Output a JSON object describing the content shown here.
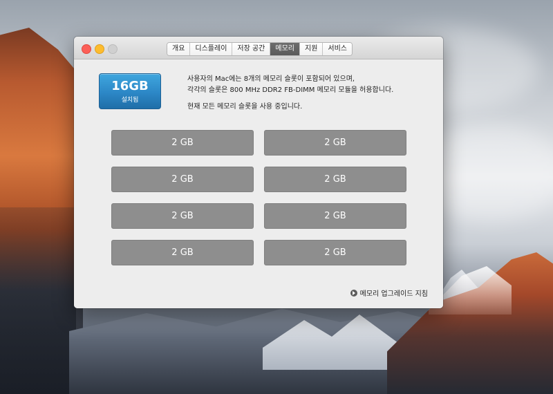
{
  "window": {
    "tabs": [
      {
        "label": "개요",
        "active": false
      },
      {
        "label": "디스플레이",
        "active": false
      },
      {
        "label": "저장 공간",
        "active": false
      },
      {
        "label": "메모리",
        "active": true
      },
      {
        "label": "지원",
        "active": false
      },
      {
        "label": "서비스",
        "active": false
      }
    ]
  },
  "memory": {
    "total": "16GB",
    "status": "설치됨",
    "description_line1": "사용자의 Mac에는 8개의 메모리 슬롯이 포함되어 있으며,",
    "description_line2": "각각의 슬롯은 800 MHz DDR2 FB-DIMM 메모리 모듈을 허용합니다.",
    "description_line3": "현재 모든 메모리 슬롯을 사용 중입니다.",
    "slots": [
      "2 GB",
      "2 GB",
      "2 GB",
      "2 GB",
      "2 GB",
      "2 GB",
      "2 GB",
      "2 GB"
    ],
    "slot_color": "#8e8e8e",
    "accent_color": "#2c87c6"
  },
  "footer": {
    "upgrade_link": "메모리 업그레이드 지침",
    "link_icon": "arrow-circle-icon"
  }
}
